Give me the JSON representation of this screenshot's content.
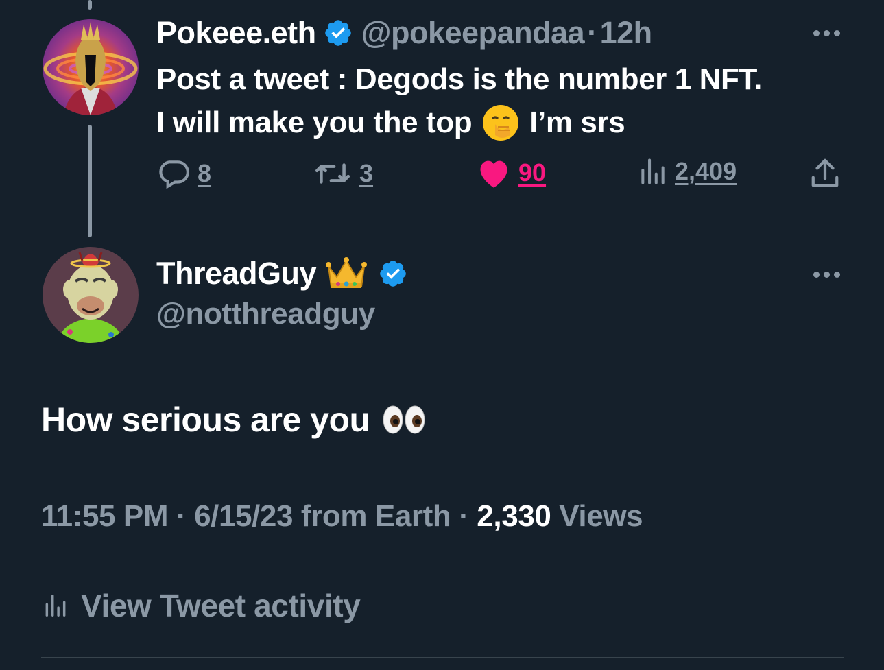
{
  "reply_to": {
    "display_name": "Pokeee.eth",
    "handle": "@pokeepandaa",
    "separator": "·",
    "time": "12h",
    "text_line1": "Post a tweet : Degods is the number 1 NFT.",
    "text_line2_before": "I will make you the top",
    "text_line2_after": "I’m srs",
    "actions": {
      "replies": "8",
      "retweets": "3",
      "likes": "90",
      "views": "2,409"
    }
  },
  "main_tweet": {
    "display_name": "ThreadGuy",
    "handle": "@notthreadguy",
    "text": "How serious are you",
    "time": "11:55 PM",
    "sep1": "·",
    "date_source": "6/15/23 from Earth",
    "sep2": "·",
    "views_count": "2,330",
    "views_label": "Views",
    "activity_label": "View Tweet activity"
  },
  "colors": {
    "background": "#15202b",
    "secondary_text": "#8b98a5",
    "like_pink": "#f91880",
    "verified_blue": "#1d9bf0",
    "divider": "#38444d"
  },
  "icons": {
    "verified": "verified-badge-icon",
    "reply": "reply-icon",
    "retweet": "retweet-icon",
    "like": "heart-icon",
    "views": "views-bar-chart-icon",
    "share": "share-icon",
    "more": "more-dots-icon",
    "crown": "crown-emoji",
    "hand_over_mouth": "face-with-hand-over-mouth-emoji",
    "eyes": "eyes-emoji"
  }
}
